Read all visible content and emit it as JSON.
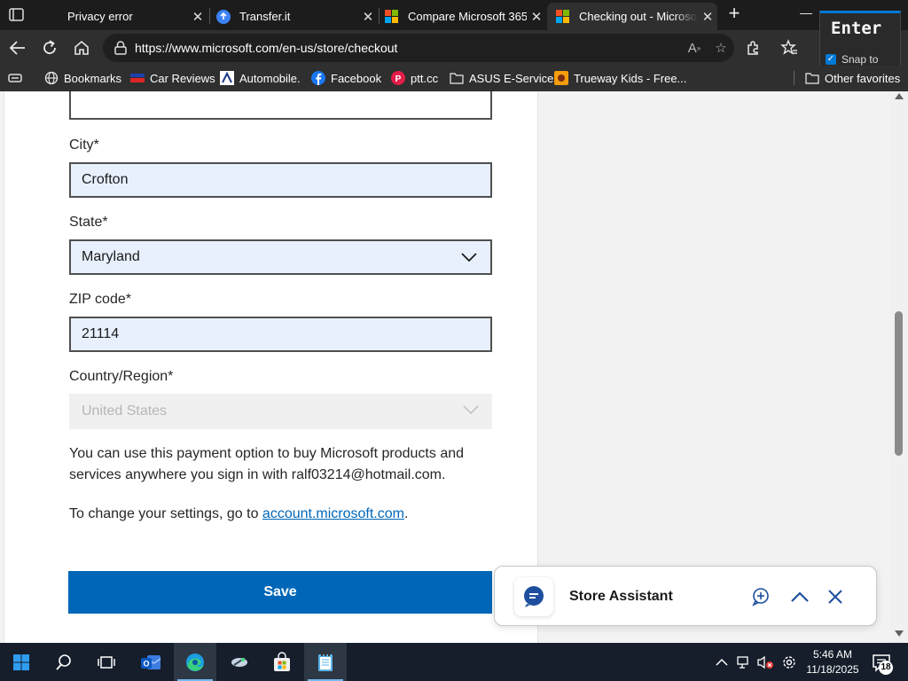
{
  "browser": {
    "tabs": [
      {
        "label": "Privacy error",
        "active": false
      },
      {
        "label": "Transfer.it",
        "active": false
      },
      {
        "label": "Compare Microsoft 365",
        "active": false
      },
      {
        "label": "Checking out - Microsoft",
        "active": true
      }
    ],
    "url": "https://www.microsoft.com/en-us/store/checkout",
    "overlay": {
      "key_label": "Enter",
      "snap_label": "Snap to"
    },
    "bookmarks": [
      {
        "label": "Bookmarks",
        "icon": "globe-icon"
      },
      {
        "label": "Car Reviews",
        "icon": "car-reviews-icon"
      },
      {
        "label": "Automobile.",
        "icon": "automobile-icon"
      },
      {
        "label": "Facebook",
        "icon": "facebook-icon"
      },
      {
        "label": "ptt.cc",
        "icon": "ptt-icon"
      },
      {
        "label": "ASUS E-Service",
        "icon": "folder-icon"
      },
      {
        "label": "Trueway Kids - Free...",
        "icon": "trueway-icon"
      }
    ],
    "other_favorites": "Other favorites"
  },
  "form": {
    "city": {
      "label": "City*",
      "value": "Crofton"
    },
    "state": {
      "label": "State*",
      "value": "Maryland"
    },
    "zip": {
      "label": "ZIP code*",
      "value": "21114"
    },
    "country": {
      "label": "Country/Region*",
      "value": "United States",
      "disabled": true
    },
    "info_text": "You can use this payment option to buy Microsoft products and services anywhere you sign in with ralf03214@hotmail.com.",
    "settings_prefix": "To change your settings, go to ",
    "settings_link": "account.microsoft.com",
    "settings_suffix": ".",
    "save_label": "Save"
  },
  "assistant": {
    "title": "Store Assistant"
  },
  "taskbar": {
    "time": "5:46 AM",
    "date": "11/18/2025",
    "notification_count": "18"
  },
  "colors": {
    "accent": "#0067b8",
    "field_fill": "#e8f0fe",
    "taskbar": "#161e2b"
  }
}
